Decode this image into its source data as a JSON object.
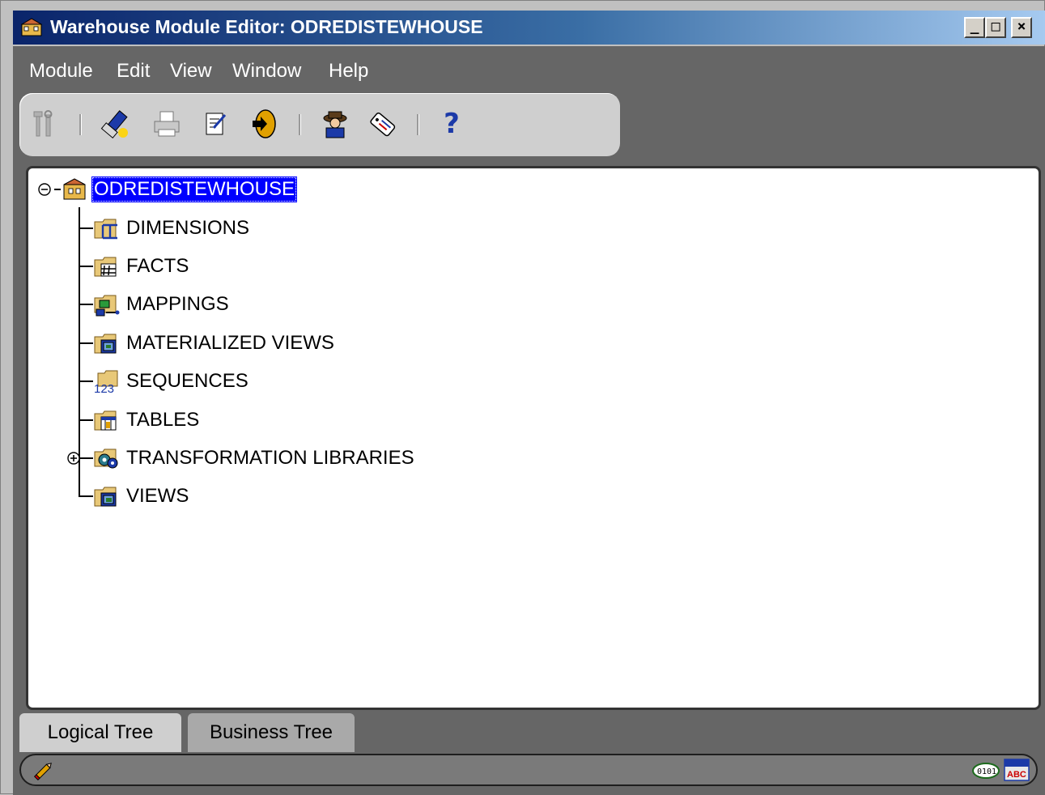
{
  "window": {
    "title": "Warehouse Module Editor: ODREDISTEWHOUSE",
    "controls": {
      "minimize": "_",
      "maximize": "□",
      "close": "×"
    }
  },
  "menu": [
    "Module",
    "Edit",
    "View",
    "Window",
    "Help"
  ],
  "toolbar": {
    "buttons": [
      "properties-icon",
      "flashlight-icon",
      "print-icon",
      "edit-doc-icon",
      "exit-icon",
      "agent-icon",
      "tag-icon",
      "help-icon"
    ],
    "help_glyph": "?"
  },
  "tree": {
    "root": {
      "label": "ODREDISTEWHOUSE",
      "expanded": true,
      "selected": true
    },
    "children": [
      {
        "label": "DIMENSIONS",
        "icon": "dimension-folder-icon"
      },
      {
        "label": "FACTS",
        "icon": "fact-folder-icon"
      },
      {
        "label": "MAPPINGS",
        "icon": "mapping-folder-icon"
      },
      {
        "label": "MATERIALIZED VIEWS",
        "icon": "mview-folder-icon"
      },
      {
        "label": "SEQUENCES",
        "icon": "sequence-folder-icon",
        "glyph": "123"
      },
      {
        "label": "TABLES",
        "icon": "table-folder-icon"
      },
      {
        "label": "TRANSFORMATION LIBRARIES",
        "icon": "transformation-folder-icon",
        "expandable": true
      },
      {
        "label": "VIEWS",
        "icon": "view-folder-icon"
      }
    ]
  },
  "tabs": [
    {
      "label": "Logical Tree",
      "active": true
    },
    {
      "label": "Business Tree",
      "active": false
    }
  ],
  "status": {
    "binary_glyph": "0101",
    "abc_glyph": "ABC"
  },
  "colors": {
    "titlebar_start": "#0a246a",
    "selection": "#0000ff",
    "background": "#666666"
  }
}
